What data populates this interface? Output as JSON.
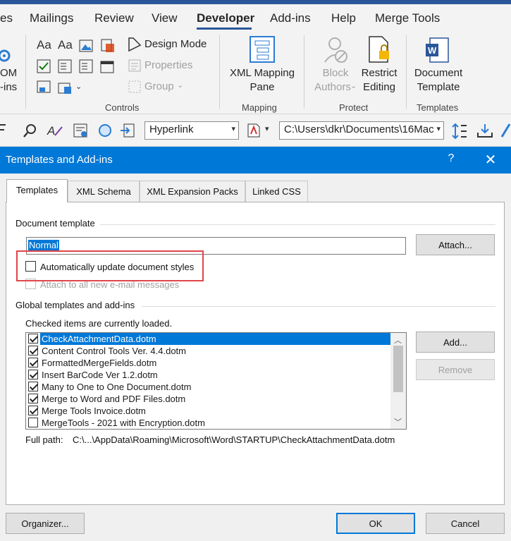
{
  "ribbon": {
    "tabs": [
      {
        "label": "es"
      },
      {
        "label": "Mailings"
      },
      {
        "label": "Review"
      },
      {
        "label": "View"
      },
      {
        "label": "Developer"
      },
      {
        "label": "Add-ins"
      },
      {
        "label": "Help"
      },
      {
        "label": "Merge Tools"
      }
    ],
    "addins_partial": {
      "line1": "OM",
      "line2": "-ins"
    },
    "controls": {
      "design_mode": "Design Mode",
      "properties": "Properties",
      "group": "Group",
      "label": "Controls"
    },
    "mapping": {
      "line1": "XML Mapping",
      "line2": "Pane",
      "label": "Mapping"
    },
    "protect": {
      "block_line1": "Block",
      "block_line2": "Authors",
      "restrict_line1": "Restrict",
      "restrict_line2": "Editing",
      "label": "Protect"
    },
    "templates": {
      "line1": "Document",
      "line2": "Template",
      "label": "Templates"
    }
  },
  "quick_toolbar": {
    "style_combo": "Hyperlink",
    "path_combo": "C:\\Users\\dkr\\Documents\\16Mac"
  },
  "dialog": {
    "title": "Templates and Add-ins",
    "help": "?",
    "close": "✕",
    "tabs": [
      {
        "label": "Templates"
      },
      {
        "label": "XML Schema"
      },
      {
        "label": "XML Expansion Packs"
      },
      {
        "label": "Linked CSS"
      }
    ],
    "document_template": {
      "section_label": "Document template",
      "value": "Normal",
      "attach_button": "Attach...",
      "auto_update_label": "Automatically update document styles",
      "auto_update_checked": false,
      "attach_email_label": "Attach to all new e-mail messages",
      "attach_email_checked": false
    },
    "global": {
      "section_label": "Global templates and add-ins",
      "hint": "Checked items are currently loaded.",
      "items": [
        {
          "name": "CheckAttachmentData.dotm",
          "checked": true
        },
        {
          "name": "Content Control Tools Ver. 4.4.dotm",
          "checked": true
        },
        {
          "name": "FormattedMergeFields.dotm",
          "checked": true
        },
        {
          "name": "Insert BarCode Ver 1.2.dotm",
          "checked": true
        },
        {
          "name": "Many to One to One Document.dotm",
          "checked": true
        },
        {
          "name": "Merge to Word and PDF Files.dotm",
          "checked": true
        },
        {
          "name": "Merge Tools Invoice.dotm",
          "checked": true
        },
        {
          "name": "MergeTools - 2021 with Encryption.dotm",
          "checked": false
        }
      ],
      "selected_index": 0,
      "add_button": "Add...",
      "remove_button": "Remove",
      "full_path_label": "Full path:",
      "full_path_value": "C:\\...\\AppData\\Roaming\\Microsoft\\Word\\STARTUP\\CheckAttachmentData.dotm"
    },
    "footer": {
      "organizer_button": "Organizer...",
      "ok_button": "OK",
      "cancel_button": "Cancel"
    }
  },
  "colors": {
    "accent": "#0078d7",
    "ribbon_brand": "#2b579a",
    "highlight_box": "#e0454a"
  }
}
